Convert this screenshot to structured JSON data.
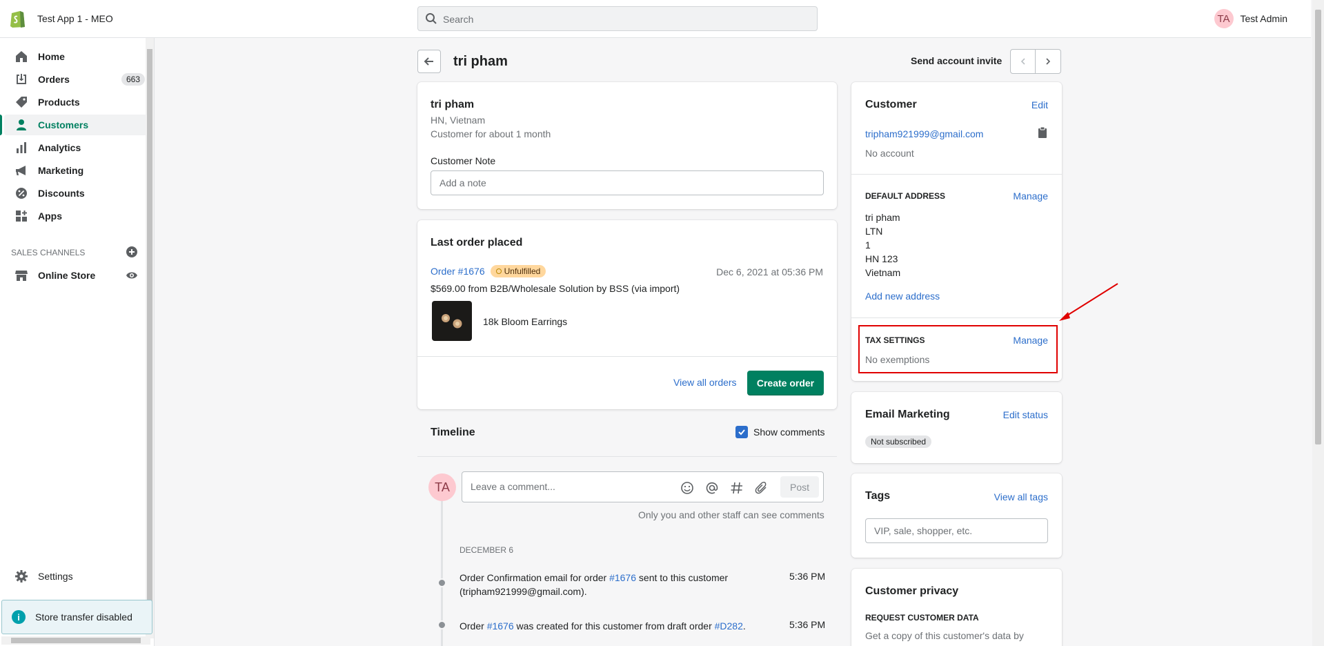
{
  "topbar": {
    "store_name": "Test App 1 - MEO",
    "search_placeholder": "Search",
    "user_initials": "TA",
    "user_name": "Test Admin"
  },
  "sidebar": {
    "items": [
      {
        "label": "Home",
        "icon": "home-icon"
      },
      {
        "label": "Orders",
        "icon": "orders-icon",
        "count": "663"
      },
      {
        "label": "Products",
        "icon": "tag-icon"
      },
      {
        "label": "Customers",
        "icon": "person-icon",
        "active": true
      },
      {
        "label": "Analytics",
        "icon": "bar-chart-icon"
      },
      {
        "label": "Marketing",
        "icon": "megaphone-icon"
      },
      {
        "label": "Discounts",
        "icon": "discount-icon"
      },
      {
        "label": "Apps",
        "icon": "apps-icon"
      }
    ],
    "sales_channels_title": "SALES CHANNELS",
    "online_store": "Online Store",
    "settings": "Settings",
    "store_transfer": "Store transfer disabled"
  },
  "header": {
    "title": "tri pham",
    "send_invite": "Send account invite"
  },
  "customer_card": {
    "name": "tri pham",
    "location": "HN, Vietnam",
    "tenure": "Customer for about 1 month",
    "note_label": "Customer Note",
    "note_placeholder": "Add a note"
  },
  "last_order": {
    "title": "Last order placed",
    "order_link": "Order #1676",
    "status": "Unfulfilled",
    "date": "Dec 6, 2021 at 05:36 PM",
    "summary": "$569.00 from B2B/Wholesale Solution by BSS (via import)",
    "product": "18k Bloom Earrings",
    "view_all": "View all orders",
    "create_order": "Create order"
  },
  "timeline": {
    "title": "Timeline",
    "show_comments": "Show comments",
    "comment_placeholder": "Leave a comment...",
    "post": "Post",
    "staff_note": "Only you and other staff can see comments",
    "date_heading": "DECEMBER 6",
    "events": [
      {
        "pre": "Order Confirmation email for order ",
        "link": "#1676",
        "post": " sent to this customer",
        "line2": "(tripham921999@gmail.com).",
        "time": "5:36 PM"
      },
      {
        "pre": "Order ",
        "link": "#1676",
        "mid": " was created for this customer from draft order ",
        "link2": "#D282",
        "post": ".",
        "time": "5:36 PM"
      }
    ]
  },
  "customer_panel": {
    "title": "Customer",
    "edit": "Edit",
    "email": "tripham921999@gmail.com",
    "account": "No account",
    "default_address_title": "DEFAULT ADDRESS",
    "manage": "Manage",
    "address_lines": [
      "tri pham",
      "LTN",
      "1",
      "HN 123",
      "Vietnam"
    ],
    "add_address": "Add new address",
    "tax_title": "TAX SETTINGS",
    "tax_manage": "Manage",
    "tax_value": "No exemptions"
  },
  "email_marketing": {
    "title": "Email Marketing",
    "edit_status": "Edit status",
    "status": "Not subscribed"
  },
  "tags": {
    "title": "Tags",
    "view_all": "View all tags",
    "placeholder": "VIP, sale, shopper, etc."
  },
  "privacy": {
    "title": "Customer privacy",
    "request_title": "REQUEST CUSTOMER DATA",
    "request_text": "Get a copy of this customer's data by"
  },
  "colors": {
    "accent": "#008060",
    "link": "#2c6ecb",
    "annotation": "#e00000"
  }
}
